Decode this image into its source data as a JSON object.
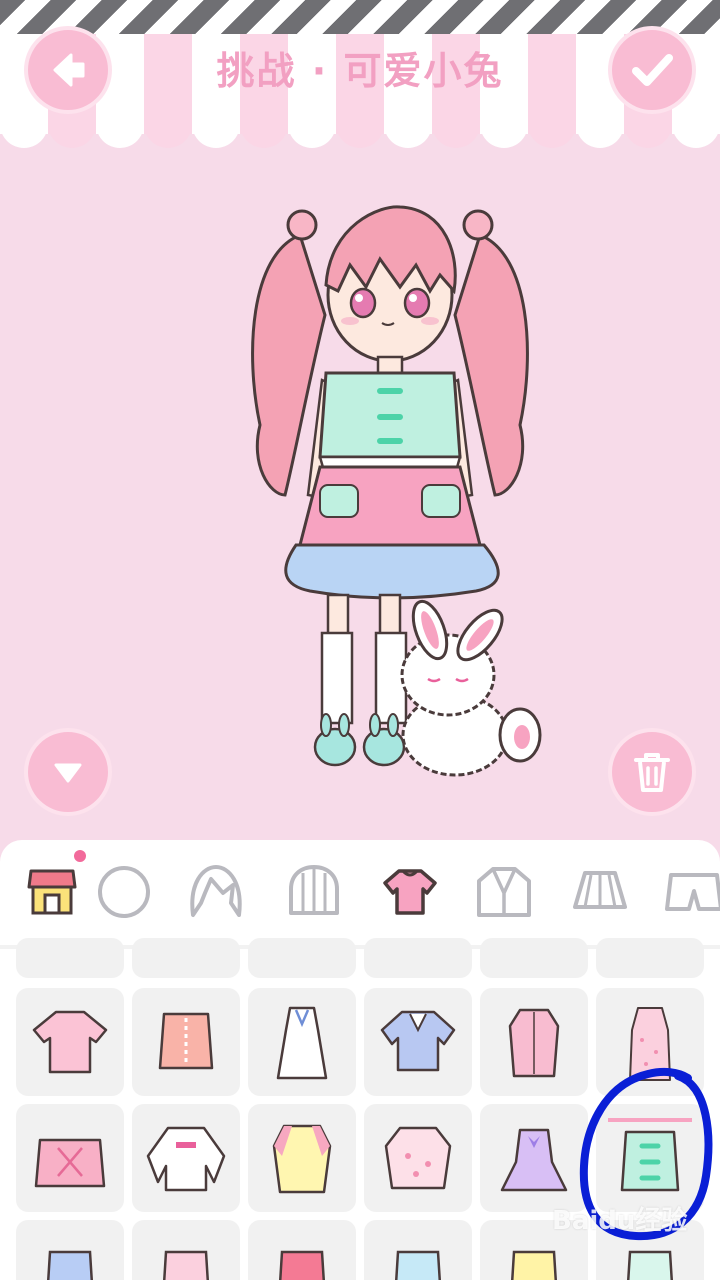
{
  "header": {
    "title": "挑战 · 可爱小兔"
  },
  "icons": {
    "back": "arrow-left-icon",
    "confirm": "check-icon",
    "expand": "chevron-down-icon",
    "delete": "trash-icon"
  },
  "categories": [
    {
      "name": "shop-icon",
      "selected": false,
      "badge": true
    },
    {
      "name": "face-icon",
      "selected": false,
      "badge": false
    },
    {
      "name": "hair-front-icon",
      "selected": false,
      "badge": false
    },
    {
      "name": "hair-back-icon",
      "selected": false,
      "badge": false
    },
    {
      "name": "top-icon",
      "selected": true,
      "badge": false
    },
    {
      "name": "jacket-icon",
      "selected": false,
      "badge": false
    },
    {
      "name": "skirt-icon",
      "selected": false,
      "badge": false
    },
    {
      "name": "shorts-icon",
      "selected": false,
      "badge": false
    }
  ],
  "items": [
    {
      "name": "pink-polo-top"
    },
    {
      "name": "peach-ruffle-camisole"
    },
    {
      "name": "white-sailor-dress"
    },
    {
      "name": "blue-bow-shirt"
    },
    {
      "name": "pink-cardigan"
    },
    {
      "name": "pink-dotted-top"
    },
    {
      "name": "pink-lace-up-top"
    },
    {
      "name": "white-sweater"
    },
    {
      "name": "yellow-raglan-tee"
    },
    {
      "name": "pink-heart-sweater"
    },
    {
      "name": "lilac-bow-dress"
    },
    {
      "name": "mint-bunny-camisole",
      "highlighted": true
    }
  ],
  "colors": {
    "background": "#f7dbe9",
    "button": "#f9bcd3",
    "title": "#f2a0c2",
    "accent": "#f26a9b",
    "highlight_circle": "#0a1fd6"
  },
  "watermark": "Baidu经验"
}
